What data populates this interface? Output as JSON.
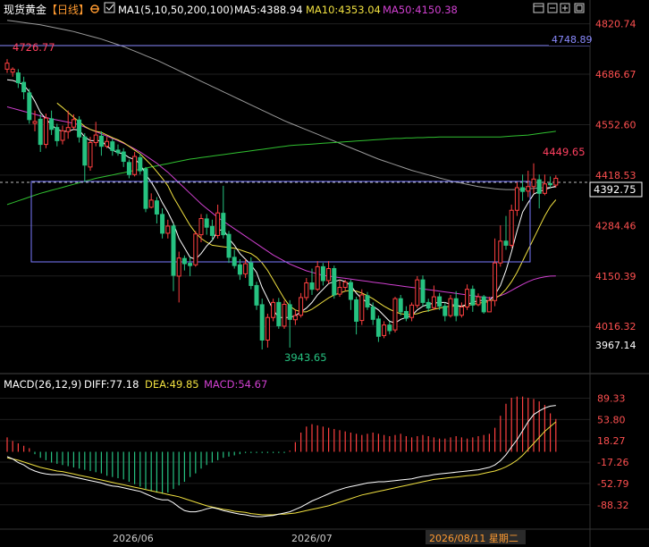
{
  "colors": {
    "up": "#ff4040",
    "down": "#26c281",
    "ma5": "#ffffff",
    "ma10": "#f0e040",
    "ma50": "#d040d0",
    "ma100": "#9a9a9a",
    "ma200": "#30c030",
    "diff": "#ffffff",
    "dea": "#f0e040",
    "macd": "#d040d0",
    "grid": "#1f1f1f",
    "box": "#7a7aff",
    "last": "#d0d0d0"
  },
  "header": {
    "title": "现货黄金",
    "period": "【日线】",
    "settings_icon": "gear-icon",
    "ma_icon": "checkbox-icon",
    "ma_params": "MA1(5,10,50,200,100)",
    "ma5": "MA5:4388.94",
    "ma10": "MA10:4353.04",
    "ma50": "MA50:4150.38"
  },
  "toolbar": {
    "icons": [
      "window-icon",
      "minus-icon",
      "add-icon",
      "restore-icon"
    ]
  },
  "macd_header": {
    "params": "MACD(26,12,9)",
    "diff": "DIFF:77.18",
    "dea": "DEA:49.85",
    "macd": "MACD:54.67"
  },
  "annotations": {
    "high_left": "4726.77",
    "high_right": "4449.65",
    "low": "3943.65",
    "hline_label": "4748.89",
    "current_price": "4392.75"
  },
  "dates": {
    "d1": "2026/06",
    "d2": "2026/07",
    "cursor": "2026/08/11 星期二"
  },
  "chart_data": {
    "type": "candlestick",
    "price_axis_ticks": [
      4820.74,
      4686.67,
      4552.6,
      4418.53,
      4284.46,
      4150.39,
      4016.32
    ],
    "macd_axis_ticks": [
      89.33,
      53.8,
      18.27,
      -17.26,
      -52.79,
      -88.32
    ],
    "price_axis_low_label": 3967.14,
    "ylim": [
      3936,
      4834
    ],
    "macd_ylim": [
      -108,
      96
    ],
    "candles": [
      [
        4700,
        4716,
        4726.77,
        4690
      ],
      [
        4692,
        4700,
        4705,
        4680
      ],
      [
        4690,
        4664,
        4700,
        4650
      ],
      [
        4665,
        4640,
        4680,
        4620
      ],
      [
        4637,
        4566,
        4648,
        4555
      ],
      [
        4556,
        4561,
        4590,
        4535
      ],
      [
        4567,
        4500,
        4580,
        4480
      ],
      [
        4500,
        4570,
        4582,
        4490
      ],
      [
        4568,
        4540,
        4590,
        4525
      ],
      [
        4545,
        4510,
        4555,
        4495
      ],
      [
        4511,
        4536,
        4550,
        4500
      ],
      [
        4534,
        4545,
        4590,
        4515
      ],
      [
        4546,
        4566,
        4580,
        4540
      ],
      [
        4565,
        4520,
        4575,
        4505
      ],
      [
        4520,
        4445,
        4530,
        4400
      ],
      [
        4440,
        4505,
        4520,
        4430
      ],
      [
        4505,
        4525,
        4560,
        4495
      ],
      [
        4522,
        4495,
        4535,
        4470
      ],
      [
        4495,
        4508,
        4520,
        4490
      ],
      [
        4507,
        4484,
        4515,
        4470
      ],
      [
        4485,
        4478,
        4500,
        4470
      ],
      [
        4480,
        4455,
        4490,
        4440
      ],
      [
        4452,
        4420,
        4460,
        4410
      ],
      [
        4420,
        4468,
        4480,
        4415
      ],
      [
        4465,
        4430,
        4475,
        4420
      ],
      [
        4435,
        4330,
        4440,
        4320
      ],
      [
        4333,
        4352,
        4370,
        4330
      ],
      [
        4350,
        4315,
        4360,
        4290
      ],
      [
        4314,
        4264,
        4330,
        4250
      ],
      [
        4264,
        4283,
        4300,
        4250
      ],
      [
        4283,
        4152,
        4290,
        4110
      ],
      [
        4150,
        4198,
        4215,
        4080
      ],
      [
        4197,
        4183,
        4205,
        4165
      ],
      [
        4184,
        4178,
        4200,
        4150
      ],
      [
        4180,
        4262,
        4270,
        4175
      ],
      [
        4260,
        4303,
        4315,
        4240
      ],
      [
        4302,
        4280,
        4315,
        4260
      ],
      [
        4282,
        4258,
        4300,
        4245
      ],
      [
        4258,
        4318,
        4340,
        4250
      ],
      [
        4317,
        4260,
        4390,
        4250
      ],
      [
        4261,
        4200,
        4270,
        4185
      ],
      [
        4200,
        4178,
        4220,
        4170
      ],
      [
        4180,
        4155,
        4195,
        4140
      ],
      [
        4156,
        4183,
        4195,
        4145
      ],
      [
        4185,
        4125,
        4200,
        4115
      ],
      [
        4125,
        4073,
        4135,
        4060
      ],
      [
        4074,
        3980,
        4090,
        3955
      ],
      [
        3980,
        4040,
        4050,
        3960
      ],
      [
        4040,
        4080,
        4090,
        4030
      ],
      [
        4080,
        4018,
        4092,
        4010
      ],
      [
        4017,
        4075,
        4085,
        4010
      ],
      [
        4074,
        4035,
        4086,
        3960
      ],
      [
        4034,
        4045,
        4060,
        4020
      ],
      [
        4046,
        4093,
        4105,
        4040
      ],
      [
        4093,
        4132,
        4145,
        4085
      ],
      [
        4132,
        4115,
        4170,
        4100
      ],
      [
        4115,
        4175,
        4190,
        4110
      ],
      [
        4175,
        4138,
        4185,
        4125
      ],
      [
        4138,
        4170,
        4190,
        4130
      ],
      [
        4170,
        4100,
        4178,
        4090
      ],
      [
        4102,
        4120,
        4140,
        4095
      ],
      [
        4120,
        4134,
        4140,
        4110
      ],
      [
        4133,
        4088,
        4140,
        4060
      ],
      [
        4087,
        4030,
        4095,
        3995
      ],
      [
        4032,
        4100,
        4115,
        4020
      ],
      [
        4098,
        4068,
        4108,
        4060
      ],
      [
        4068,
        4035,
        4080,
        4020
      ],
      [
        4036,
        3990,
        4045,
        3975
      ],
      [
        3992,
        4020,
        4030,
        3985
      ],
      [
        4020,
        4005,
        4030,
        3995
      ],
      [
        4007,
        4090,
        4095,
        4000
      ],
      [
        4090,
        4055,
        4100,
        4045
      ],
      [
        4056,
        4038,
        4070,
        4030
      ],
      [
        4040,
        4073,
        4080,
        4030
      ],
      [
        4072,
        4140,
        4150,
        4065
      ],
      [
        4140,
        4080,
        4152,
        4070
      ],
      [
        4080,
        4065,
        4090,
        4055
      ],
      [
        4066,
        4095,
        4125,
        4060
      ],
      [
        4095,
        4070,
        4105,
        4060
      ],
      [
        4070,
        4045,
        4080,
        4030
      ],
      [
        4045,
        4090,
        4100,
        4040
      ],
      [
        4090,
        4045,
        4110,
        4030
      ],
      [
        4046,
        4068,
        4080,
        4040
      ],
      [
        4068,
        4115,
        4128,
        4060
      ],
      [
        4115,
        4073,
        4125,
        4055
      ],
      [
        4074,
        4095,
        4104,
        4070
      ],
      [
        4095,
        4055,
        4100,
        4050
      ],
      [
        4055,
        4085,
        4095,
        4055
      ],
      [
        4085,
        4185,
        4250,
        4070
      ],
      [
        4185,
        4243,
        4285,
        4175
      ],
      [
        4243,
        4232,
        4310,
        4220
      ],
      [
        4232,
        4325,
        4340,
        4225
      ],
      [
        4325,
        4385,
        4400,
        4310
      ],
      [
        4385,
        4375,
        4420,
        4350
      ],
      [
        4376,
        4388,
        4430,
        4360
      ],
      [
        4388,
        4408,
        4449.65,
        4370
      ],
      [
        4406,
        4370,
        4420,
        4330
      ],
      [
        4370,
        4395,
        4420,
        4365
      ],
      [
        4396,
        4392.75,
        4415,
        4385
      ],
      [
        4392,
        4410,
        4418,
        4385
      ]
    ],
    "ma5": [
      4672,
      4670,
      4665,
      4658,
      4640,
      4615,
      4585,
      4568,
      4552,
      4540,
      4535,
      4535,
      4540,
      4538,
      4520,
      4510,
      4510,
      4510,
      4495,
      4485,
      4478,
      4475,
      4465,
      4460,
      4448,
      4420,
      4400,
      4375,
      4345,
      4320,
      4290,
      4250,
      4225,
      4200,
      4195,
      4210,
      4230,
      4245,
      4270,
      4275,
      4250,
      4232,
      4210,
      4195,
      4180,
      4160,
      4120,
      4090,
      4060,
      4040,
      4040,
      4040,
      4045,
      4055,
      4065,
      4080,
      4100,
      4115,
      4130,
      4135,
      4140,
      4135,
      4125,
      4105,
      4090,
      4080,
      4070,
      4060,
      4045,
      4030,
      4025,
      4035,
      4040,
      4045,
      4060,
      4070,
      4075,
      4078,
      4080,
      4080,
      4075,
      4072,
      4070,
      4075,
      4080,
      4085,
      4085,
      4085,
      4100,
      4125,
      4165,
      4215,
      4270,
      4320,
      4345,
      4368,
      4375,
      4380,
      4385,
      4388.94
    ],
    "ma10": [
      null,
      null,
      null,
      null,
      null,
      null,
      null,
      null,
      null,
      4610,
      4598,
      4585,
      4572,
      4560,
      4548,
      4540,
      4535,
      4532,
      4525,
      4518,
      4512,
      4505,
      4495,
      4485,
      4475,
      4460,
      4445,
      4428,
      4410,
      4390,
      4360,
      4335,
      4310,
      4285,
      4265,
      4250,
      4240,
      4232,
      4230,
      4228,
      4226,
      4224,
      4220,
      4215,
      4210,
      4200,
      4185,
      4165,
      4140,
      4115,
      4090,
      4070,
      4060,
      4055,
      4055,
      4062,
      4072,
      4082,
      4092,
      4100,
      4105,
      4110,
      4112,
      4110,
      4105,
      4098,
      4090,
      4080,
      4070,
      4062,
      4055,
      4050,
      4048,
      4048,
      4050,
      4055,
      4058,
      4062,
      4065,
      4068,
      4070,
      4070,
      4070,
      4072,
      4075,
      4078,
      4080,
      4082,
      4090,
      4100,
      4115,
      4135,
      4160,
      4190,
      4220,
      4250,
      4280,
      4310,
      4335,
      4353.04
    ],
    "ma50": [
      4600,
      4596,
      4592,
      4588,
      4584,
      4580,
      4576,
      4572,
      4568,
      4565,
      4562,
      4559,
      4556,
      4552,
      4546,
      4540,
      4534,
      4528,
      4522,
      4516,
      4510,
      4503,
      4496,
      4488,
      4480,
      4470,
      4460,
      4450,
      4438,
      4426,
      4412,
      4398,
      4384,
      4370,
      4356,
      4342,
      4330,
      4318,
      4306,
      4296,
      4286,
      4276,
      4266,
      4256,
      4246,
      4236,
      4226,
      4216,
      4206,
      4198,
      4190,
      4182,
      4176,
      4170,
      4164,
      4160,
      4156,
      4152,
      4150,
      4148,
      4146,
      4144,
      4142,
      4140,
      4138,
      4136,
      4134,
      4132,
      4130,
      4128,
      4126,
      4124,
      4122,
      4120,
      4118,
      4116,
      4114,
      4112,
      4110,
      4108,
      4106,
      4104,
      4102,
      4100,
      4098,
      4096,
      4094,
      4092,
      4094,
      4098,
      4104,
      4112,
      4120,
      4128,
      4135,
      4141,
      4145,
      4148,
      4150,
      4150.38
    ],
    "ma100": [
      4830,
      4828,
      4826,
      4824,
      4822,
      4820,
      4818,
      4815,
      4812,
      4809,
      4806,
      4803,
      4800,
      4796,
      4792,
      4788,
      4784,
      4780,
      4775,
      4770,
      4765,
      4760,
      4754,
      4748,
      4742,
      4736,
      4730,
      4724,
      4717,
      4710,
      4703,
      4696,
      4689,
      4682,
      4675,
      4668,
      4661,
      4654,
      4647,
      4640,
      4633,
      4626,
      4619,
      4612,
      4605,
      4598,
      4591,
      4584,
      4577,
      4570,
      4563,
      4557,
      4551,
      4545,
      4539,
      4533,
      4527,
      4521,
      4515,
      4509,
      4503,
      4497,
      4491,
      4485,
      4479,
      4473,
      4467,
      4461,
      4456,
      4451,
      4446,
      4441,
      4436,
      4431,
      4427,
      4423,
      4419,
      4415,
      4411,
      4407,
      4403,
      4400,
      4397,
      4394,
      4391,
      4388,
      4386,
      4384,
      4382,
      4381,
      4380,
      4380,
      4380,
      4381,
      4382,
      4383,
      4384,
      4385,
      4386,
      4387
    ],
    "ma200": [
      4340,
      4345,
      4350,
      4355,
      4360,
      4365,
      4370,
      4374,
      4378,
      4382,
      4386,
      4390,
      4394,
      4398,
      4402,
      4406,
      4410,
      4413,
      4416,
      4419,
      4422,
      4425,
      4428,
      4431,
      4434,
      4437,
      4440,
      4443,
      4446,
      4449,
      4452,
      4455,
      4458,
      4461,
      4463,
      4465,
      4467,
      4469,
      4471,
      4473,
      4475,
      4477,
      4479,
      4481,
      4483,
      4485,
      4487,
      4489,
      4491,
      4493,
      4495,
      4497,
      4498,
      4499,
      4500,
      4501,
      4502,
      4503,
      4504,
      4505,
      4506,
      4507,
      4508,
      4509,
      4510,
      4511,
      4512,
      4513,
      4514,
      4515,
      4516,
      4516,
      4517,
      4517,
      4518,
      4518,
      4519,
      4519,
      4520,
      4520,
      4520,
      4520,
      4520,
      4520,
      4520,
      4520,
      4520,
      4520,
      4520,
      4520,
      4521,
      4522,
      4523,
      4524,
      4525,
      4527,
      4529,
      4531,
      4533,
      4535
    ],
    "macd_diff": [
      -8,
      -12,
      -18,
      -22,
      -28,
      -32,
      -35,
      -37,
      -38,
      -38,
      -38,
      -40,
      -42,
      -44,
      -46,
      -48,
      -50,
      -52,
      -55,
      -57,
      -58,
      -60,
      -62,
      -64,
      -66,
      -70,
      -74,
      -78,
      -80,
      -80,
      -85,
      -92,
      -98,
      -100,
      -100,
      -98,
      -95,
      -93,
      -95,
      -98,
      -100,
      -102,
      -104,
      -105,
      -107,
      -108,
      -108,
      -107,
      -106,
      -104,
      -102,
      -100,
      -96,
      -92,
      -87,
      -82,
      -78,
      -74,
      -70,
      -66,
      -63,
      -60,
      -58,
      -56,
      -54,
      -52,
      -51,
      -50,
      -50,
      -49,
      -48,
      -47,
      -46,
      -45,
      -43,
      -41,
      -40,
      -38,
      -37,
      -36,
      -35,
      -34,
      -33,
      -32,
      -31,
      -30,
      -28,
      -26,
      -22,
      -15,
      -5,
      8,
      20,
      35,
      50,
      62,
      68,
      73,
      76,
      77.18
    ],
    "macd_dea": [
      -10,
      -12,
      -14,
      -17,
      -20,
      -23,
      -26,
      -28,
      -30,
      -32,
      -33,
      -35,
      -37,
      -39,
      -41,
      -43,
      -45,
      -47,
      -49,
      -51,
      -53,
      -55,
      -57,
      -59,
      -61,
      -63,
      -65,
      -67,
      -69,
      -71,
      -73,
      -75,
      -78,
      -81,
      -84,
      -87,
      -90,
      -92,
      -94,
      -96,
      -97,
      -99,
      -100,
      -101,
      -103,
      -104,
      -105,
      -105,
      -105,
      -104,
      -104,
      -103,
      -102,
      -100,
      -98,
      -96,
      -94,
      -92,
      -90,
      -87,
      -84,
      -81,
      -78,
      -75,
      -72,
      -70,
      -68,
      -66,
      -64,
      -62,
      -60,
      -58,
      -56,
      -54,
      -52,
      -50,
      -48,
      -46,
      -45,
      -44,
      -43,
      -42,
      -41,
      -40,
      -39,
      -38,
      -36,
      -34,
      -32,
      -29,
      -25,
      -20,
      -14,
      -6,
      4,
      14,
      24,
      34,
      42,
      49.85
    ],
    "macd_hist": [
      24,
      18,
      14,
      10,
      6,
      -4,
      -10,
      -14,
      -18,
      -20,
      -22,
      -24,
      -26,
      -28,
      -30,
      -32,
      -34,
      -36,
      -40,
      -42,
      -44,
      -46,
      -50,
      -54,
      -58,
      -62,
      -66,
      -68,
      -70,
      -68,
      -62,
      -56,
      -50,
      -42,
      -36,
      -28,
      -22,
      -18,
      -14,
      -10,
      -8,
      -6,
      -4,
      -2,
      -2,
      -2,
      -2,
      -2,
      -2,
      -2,
      -2,
      2,
      16,
      32,
      42,
      46,
      44,
      42,
      40,
      38,
      36,
      34,
      32,
      30,
      28,
      30,
      32,
      30,
      28,
      26,
      28,
      30,
      26,
      24,
      26,
      28,
      26,
      24,
      22,
      22,
      24,
      26,
      24,
      22,
      24,
      26,
      28,
      30,
      40,
      60,
      80,
      90,
      92,
      92,
      90,
      88,
      84,
      78,
      64,
      54.67
    ]
  }
}
